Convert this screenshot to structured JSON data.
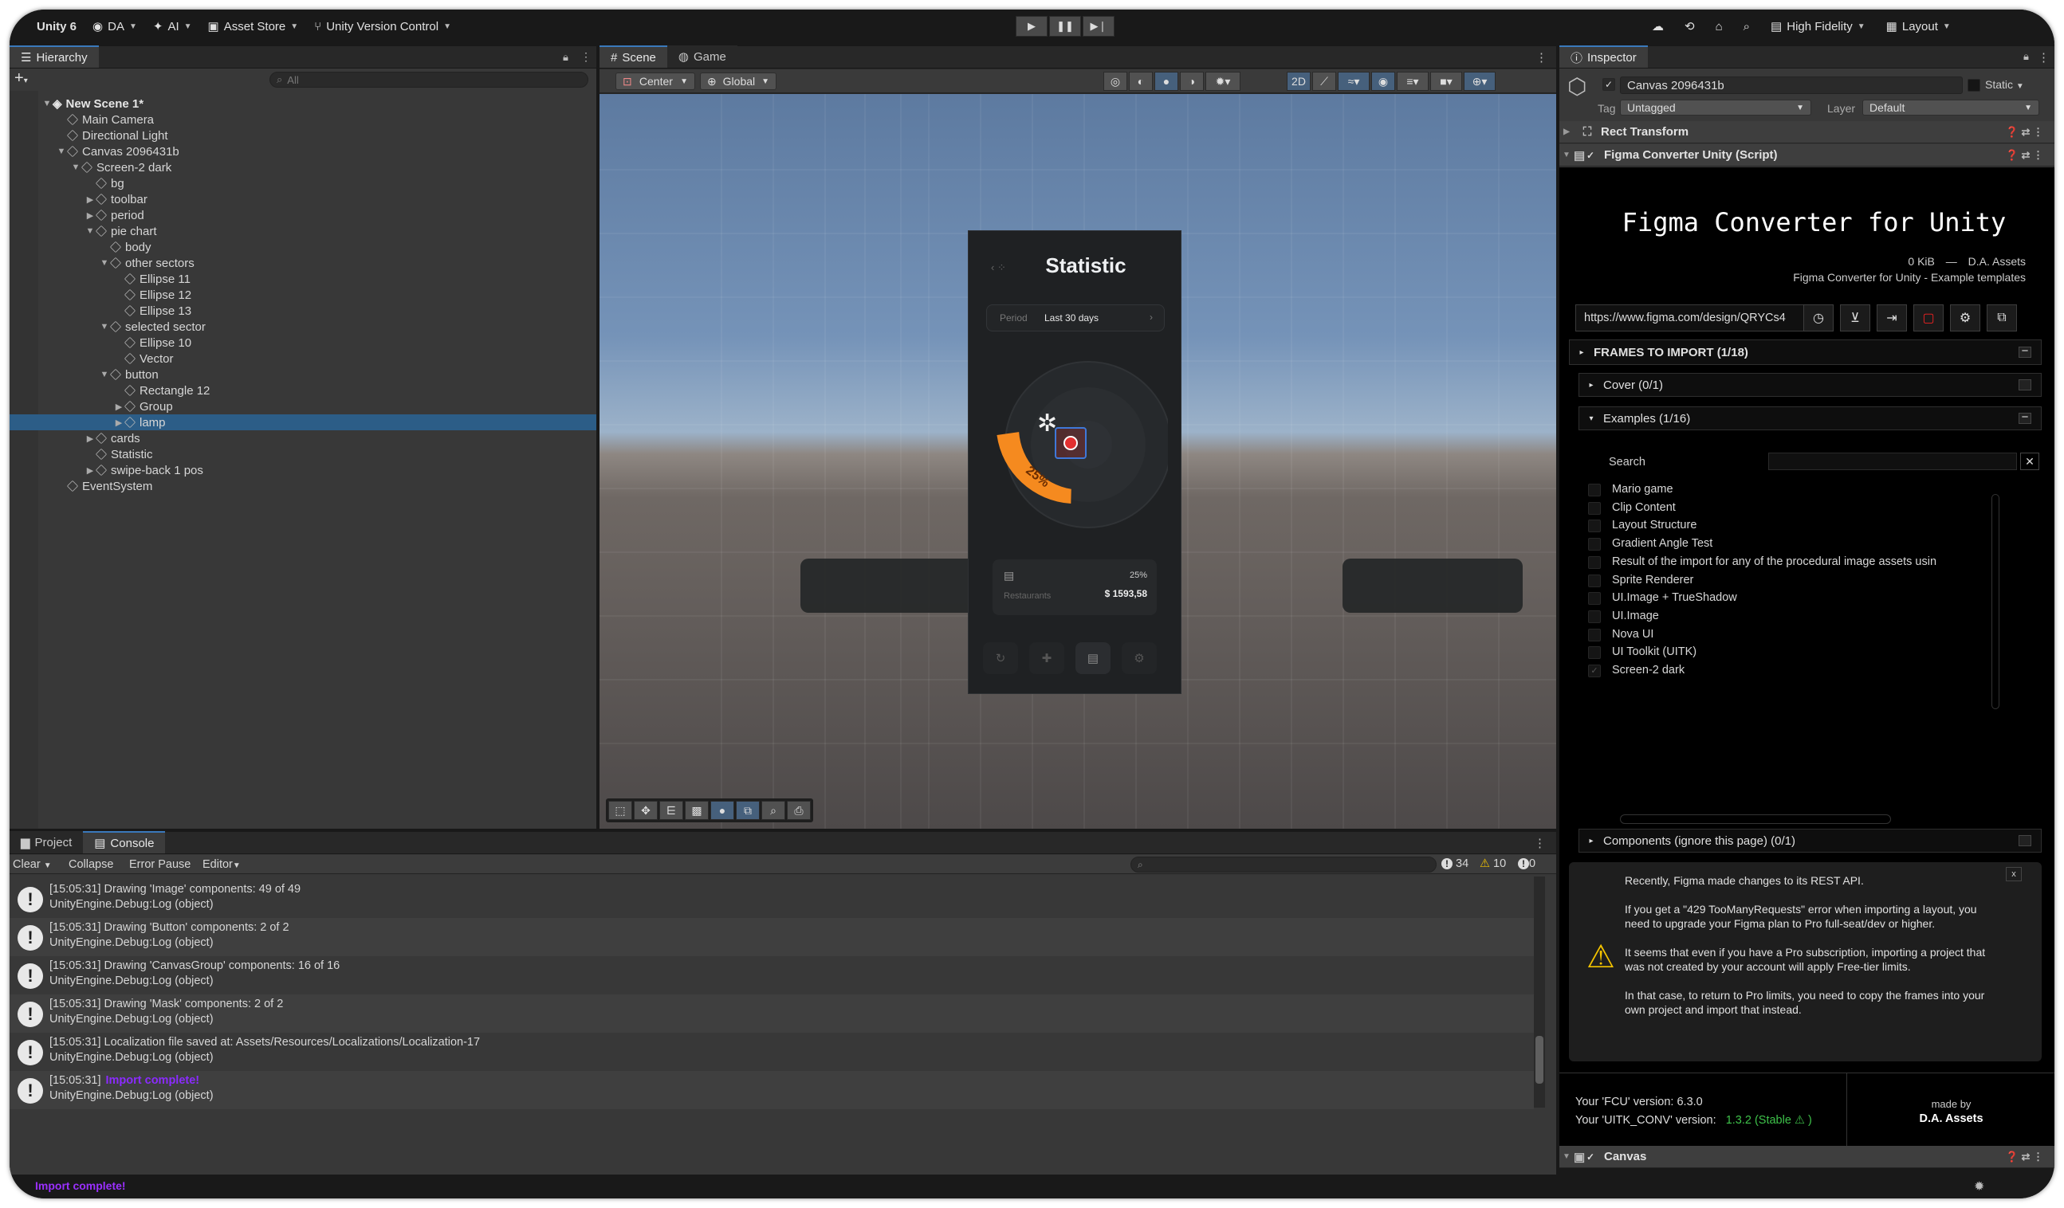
{
  "toolbar": {
    "app": "Unity 6",
    "account": "DA",
    "ai": "AI",
    "asset_store": "Asset Store",
    "vcs": "Unity Version Control",
    "quality": "High Fidelity",
    "layout": "Layout"
  },
  "hierarchy": {
    "tab": "Hierarchy",
    "search_placeholder": "All",
    "scene": "New Scene 1*",
    "items": [
      {
        "label": "Main Camera",
        "depth": 1,
        "arrow": ""
      },
      {
        "label": "Directional Light",
        "depth": 1,
        "arrow": ""
      },
      {
        "label": "Canvas 2096431b",
        "depth": 1,
        "arrow": "▼"
      },
      {
        "label": "Screen-2 dark",
        "depth": 2,
        "arrow": "▼"
      },
      {
        "label": "bg",
        "depth": 3,
        "arrow": ""
      },
      {
        "label": "toolbar",
        "depth": 3,
        "arrow": "▶"
      },
      {
        "label": "period",
        "depth": 3,
        "arrow": "▶"
      },
      {
        "label": "pie chart",
        "depth": 3,
        "arrow": "▼"
      },
      {
        "label": "body",
        "depth": 4,
        "arrow": ""
      },
      {
        "label": "other sectors",
        "depth": 4,
        "arrow": "▼"
      },
      {
        "label": "Ellipse 11",
        "depth": 5,
        "arrow": ""
      },
      {
        "label": "Ellipse 12",
        "depth": 5,
        "arrow": ""
      },
      {
        "label": "Ellipse 13",
        "depth": 5,
        "arrow": ""
      },
      {
        "label": "selected sector",
        "depth": 4,
        "arrow": "▼"
      },
      {
        "label": "Ellipse 10",
        "depth": 5,
        "arrow": ""
      },
      {
        "label": "Vector",
        "depth": 5,
        "arrow": ""
      },
      {
        "label": "button",
        "depth": 4,
        "arrow": "▼"
      },
      {
        "label": "Rectangle 12",
        "depth": 5,
        "arrow": ""
      },
      {
        "label": "Group",
        "depth": 5,
        "arrow": "▶"
      },
      {
        "label": "lamp",
        "depth": 5,
        "arrow": "▶",
        "selected": true
      },
      {
        "label": "cards",
        "depth": 3,
        "arrow": "▶"
      },
      {
        "label": "Statistic",
        "depth": 3,
        "arrow": ""
      },
      {
        "label": "swipe-back 1 pos",
        "depth": 3,
        "arrow": "▶"
      },
      {
        "label": "EventSystem",
        "depth": 1,
        "arrow": ""
      }
    ]
  },
  "scene": {
    "tab_scene": "Scene",
    "tab_game": "Game",
    "pivot": "Center",
    "space": "Global",
    "mode_2d": "2D",
    "phone": {
      "title": "Statistic",
      "period_label": "Period",
      "period_value": "Last 30 days",
      "sector_label": "25%",
      "card_pct": "25%",
      "card_name": "Restaurants",
      "card_amount": "$ 1593,58"
    }
  },
  "console": {
    "tab_project": "Project",
    "tab_console": "Console",
    "clear": "Clear",
    "collapse": "Collapse",
    "error_pause": "Error Pause",
    "editor": "Editor",
    "count_log": "34",
    "count_warn": "10",
    "count_err": "0",
    "rows": [
      {
        "l1": "[15:05:31] Drawing 'Image' components: 49 of 49",
        "l2": "UnityEngine.Debug:Log (object)"
      },
      {
        "l1": "[15:05:31] Drawing 'Button' components: 2 of 2",
        "l2": "UnityEngine.Debug:Log (object)"
      },
      {
        "l1": "[15:05:31] Drawing 'CanvasGroup' components: 16 of 16",
        "l2": "UnityEngine.Debug:Log (object)"
      },
      {
        "l1": "[15:05:31] Drawing 'Mask' components: 2 of 2",
        "l2": "UnityEngine.Debug:Log (object)"
      },
      {
        "l1": "[15:05:31] Localization file saved at: Assets/Resources/Localizations/Localization-17",
        "l2": "UnityEngine.Debug:Log (object)"
      },
      {
        "l1": "[15:05:31]",
        "l1_highlight": "Import complete!",
        "l2": "UnityEngine.Debug:Log (object)"
      }
    ],
    "status": "Import complete!"
  },
  "inspector": {
    "tab": "Inspector",
    "object_name": "Canvas 2096431b",
    "static": "Static",
    "tag_label": "Tag",
    "tag_value": "Untagged",
    "layer_label": "Layer",
    "layer_value": "Default",
    "rect_transform": "Rect Transform",
    "script": "Figma Converter Unity (Script)",
    "fcu_title": "Figma Converter for Unity",
    "size": "0 KiB",
    "separator": "—",
    "vendor": "D.A. Assets",
    "project_name": "Figma Converter for Unity - Example templates",
    "url": "https://www.figma.com/design/QRYCs4",
    "frames_header": "FRAMES TO IMPORT (1/18)",
    "cover": "Cover (0/1)",
    "examples": "Examples (1/16)",
    "search_label": "Search",
    "frames": [
      "Mario game",
      "Clip Content",
      "Layout Structure",
      "Gradient Angle Test",
      "Result of the import for any of the procedural image assets usin",
      "Sprite Renderer",
      "UI.Image + TrueShadow",
      "UI.Image",
      "Nova UI",
      "UI Toolkit (UITK)",
      "Screen-2 dark"
    ],
    "components": "Components (ignore this page) (0/1)",
    "notice": [
      "Recently, Figma made changes to its REST API.",
      "If you get a \"429 TooManyRequests\" error when importing a layout, you need to upgrade your Figma plan to Pro full-seat/dev or higher.",
      "It seems that even if you have a Pro subscription, importing a project that was not created by your account will apply Free-tier limits.",
      "In that case, to return to Pro limits, you need to copy the frames into your own project and import that instead."
    ],
    "fcu_version": "Your 'FCU' version: 6.3.0",
    "uitk_label": "Your 'UITK_CONV' version:",
    "uitk_value": "1.3.2 (Stable",
    "made_by": "made by",
    "made_by_name": "D.A. Assets",
    "canvas_component": "Canvas"
  }
}
